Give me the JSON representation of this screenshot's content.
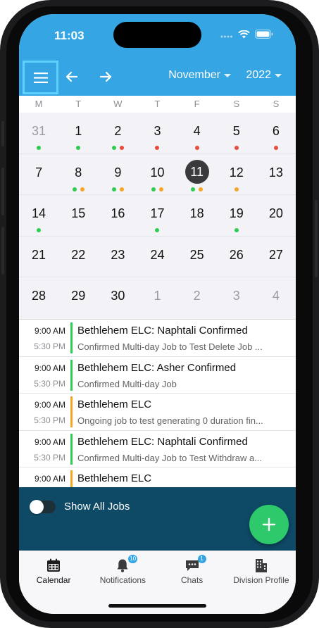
{
  "status_bar": {
    "time": "11:03"
  },
  "header": {
    "month": "November",
    "year": "2022"
  },
  "weekdays": [
    "M",
    "T",
    "W",
    "T",
    "F",
    "S",
    "S"
  ],
  "colors": {
    "accent": "#35a6e3",
    "green": "#2ecc53",
    "red": "#e84a3b",
    "orange": "#f5a623",
    "footer": "#0e4a66",
    "fab": "#2dc96a"
  },
  "calendar": {
    "weeks": [
      [
        {
          "num": "31",
          "muted": true,
          "dots": [
            "green"
          ]
        },
        {
          "num": "1",
          "dots": [
            "green"
          ]
        },
        {
          "num": "2",
          "dots": [
            "green",
            "red"
          ]
        },
        {
          "num": "3",
          "dots": [
            "red"
          ]
        },
        {
          "num": "4",
          "dots": [
            "red"
          ]
        },
        {
          "num": "5",
          "dots": [
            "red"
          ]
        },
        {
          "num": "6",
          "dots": [
            "red"
          ]
        }
      ],
      [
        {
          "num": "7",
          "dots": []
        },
        {
          "num": "8",
          "dots": [
            "green",
            "orange"
          ]
        },
        {
          "num": "9",
          "dots": [
            "green",
            "orange"
          ]
        },
        {
          "num": "10",
          "dots": [
            "green",
            "orange"
          ]
        },
        {
          "num": "11",
          "selected": true,
          "dots": [
            "green",
            "orange"
          ]
        },
        {
          "num": "12",
          "dots": [
            "orange"
          ]
        },
        {
          "num": "13",
          "dots": []
        }
      ],
      [
        {
          "num": "14",
          "dots": [
            "green"
          ]
        },
        {
          "num": "15",
          "dots": []
        },
        {
          "num": "16",
          "dots": []
        },
        {
          "num": "17",
          "dots": [
            "green"
          ]
        },
        {
          "num": "18",
          "dots": []
        },
        {
          "num": "19",
          "dots": [
            "green"
          ]
        },
        {
          "num": "20",
          "dots": []
        }
      ],
      [
        {
          "num": "21",
          "dots": []
        },
        {
          "num": "22",
          "dots": []
        },
        {
          "num": "23",
          "dots": []
        },
        {
          "num": "24",
          "dots": []
        },
        {
          "num": "25",
          "dots": []
        },
        {
          "num": "26",
          "dots": []
        },
        {
          "num": "27",
          "dots": []
        }
      ],
      [
        {
          "num": "28",
          "dots": []
        },
        {
          "num": "29",
          "dots": []
        },
        {
          "num": "30",
          "dots": []
        },
        {
          "num": "1",
          "muted": true,
          "dots": []
        },
        {
          "num": "2",
          "muted": true,
          "dots": []
        },
        {
          "num": "3",
          "muted": true,
          "dots": []
        },
        {
          "num": "4",
          "muted": true,
          "dots": []
        }
      ]
    ]
  },
  "jobs": [
    {
      "start": "9:00 AM",
      "end": "5:30 PM",
      "title": "Bethlehem ELC: Naphtali Confirmed",
      "subtitle": "Confirmed Multi-day Job to Test Delete Job ...",
      "status": "green"
    },
    {
      "start": "9:00 AM",
      "end": "5:30 PM",
      "title": "Bethlehem ELC: Asher Confirmed",
      "subtitle": "Confirmed Multi-day Job",
      "status": "green"
    },
    {
      "start": "9:00 AM",
      "end": "5:30 PM",
      "title": "Bethlehem ELC",
      "subtitle": "Ongoing job to test generating 0 duration fin...",
      "status": "orange"
    },
    {
      "start": "9:00 AM",
      "end": "5:30 PM",
      "title": "Bethlehem ELC: Naphtali Confirmed",
      "subtitle": "Confirmed Multi-day Job to Test Withdraw a...",
      "status": "green"
    },
    {
      "start": "9:00 AM",
      "end": "",
      "title": "Bethlehem ELC",
      "subtitle": "",
      "status": "orange"
    }
  ],
  "footer": {
    "toggle_label": "Show All Jobs",
    "toggle_on": false,
    "fab_icon": "plus-icon"
  },
  "tabs": [
    {
      "label": "Calendar",
      "icon": "calendar-icon",
      "active": true,
      "badge": ""
    },
    {
      "label": "Notifications",
      "icon": "bell-icon",
      "active": false,
      "badge": "10"
    },
    {
      "label": "Chats",
      "icon": "chat-icon",
      "active": false,
      "badge": "1"
    },
    {
      "label": "Division Profile",
      "icon": "building-icon",
      "active": false,
      "badge": ""
    }
  ]
}
